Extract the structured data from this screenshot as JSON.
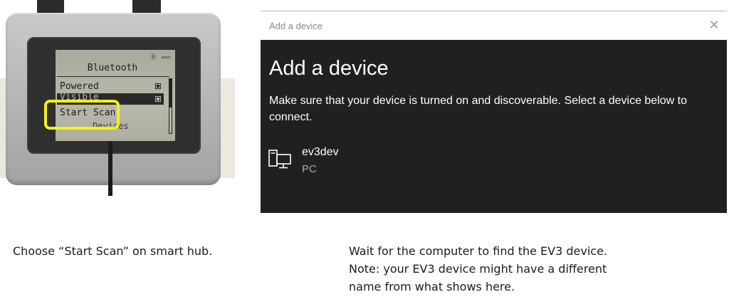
{
  "ev3_screen": {
    "status": "ⓑ ▭▭",
    "title": "Bluetooth",
    "items": [
      {
        "label": "Powered"
      },
      {
        "label": "Visible"
      },
      {
        "label": "Start Scan"
      },
      {
        "label": "Devices"
      }
    ],
    "highlight_color": "#f7ef1a"
  },
  "dialog": {
    "window_title": "Add a device",
    "close_icon": "close-icon",
    "heading": "Add a device",
    "description": "Make sure that your device is turned on and discoverable. Select a device below to connect.",
    "devices": [
      {
        "name": "ev3dev",
        "type": "PC",
        "icon": "pc-icon"
      }
    ],
    "background_color": "#202020"
  },
  "captions": {
    "left": "Choose “Start Scan” on smart hub.",
    "right_lines": [
      "Wait for the computer to find the EV3 device.",
      "Note: your EV3 device might have a different",
      "name from what shows here."
    ]
  }
}
